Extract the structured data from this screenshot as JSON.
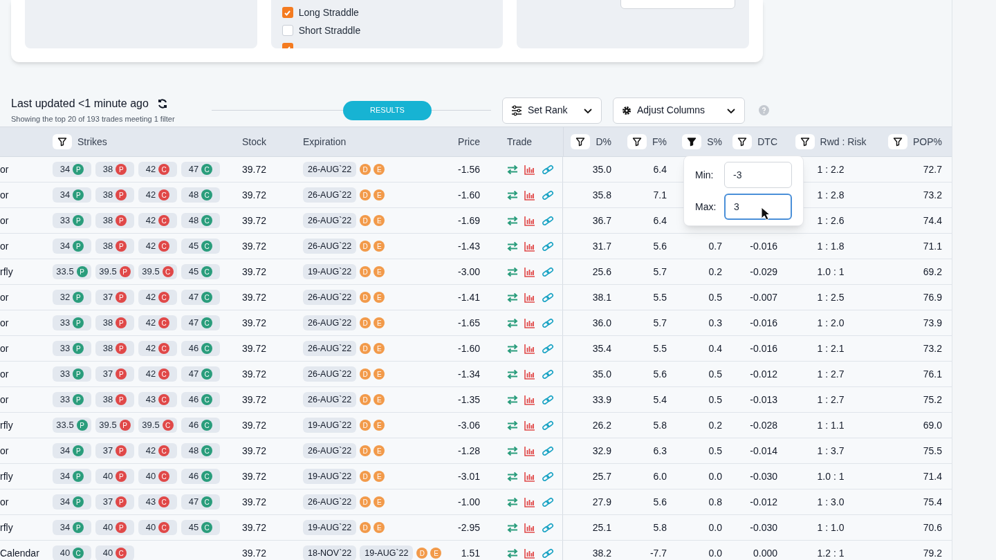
{
  "strategies_panel": {
    "items": [
      {
        "label": "Long Straddle",
        "checked": true
      },
      {
        "label": "Short Straddle",
        "checked": false
      },
      {
        "checked": true
      }
    ]
  },
  "results_header": {
    "title": "Last updated <1 minute ago",
    "subtitle": "Showing the top 20 of 193 trades meeting 1 filter",
    "divider_label": "RESULTS",
    "buttons": [
      {
        "label": "Set Rank",
        "kind": "rank"
      },
      {
        "label": "Adjust Columns",
        "kind": "columns"
      }
    ]
  },
  "table": {
    "columns": [
      {
        "label": "Strikes",
        "filter": true,
        "filter_active": false
      },
      {
        "label": "Stock",
        "filter": false
      },
      {
        "label": "Expiration",
        "filter": false
      },
      {
        "label": "Price",
        "filter": false
      },
      {
        "label": "Trade",
        "filter": false
      },
      {
        "label": "D%",
        "filter": true,
        "filter_active": false
      },
      {
        "label": "F%",
        "filter": true,
        "filter_active": false
      },
      {
        "label": "S%",
        "filter": true,
        "filter_active": true
      },
      {
        "label": "DTC",
        "filter": true,
        "filter_active": false
      },
      {
        "label": "Rwd : Risk",
        "filter": true,
        "filter_active": false
      },
      {
        "label": "POP%",
        "filter": true,
        "filter_active": false
      }
    ],
    "rows": [
      {
        "name": "or",
        "strikes": [
          {
            "value": "34",
            "type": "P",
            "color": "#2a9d7c"
          },
          {
            "value": "38",
            "type": "P",
            "color": "#e04848"
          },
          {
            "value": "42",
            "type": "C",
            "color": "#e04848"
          },
          {
            "value": "47",
            "type": "C",
            "color": "#2a9d7c"
          }
        ],
        "stock": "39.72",
        "expirations": [
          "26-AUG`22"
        ],
        "badges": [
          "D",
          "E"
        ],
        "price": "-1.56",
        "d": "35.0",
        "f": "6.4",
        "rwd_risk": "1 : 2.2",
        "pop": "72.7"
      },
      {
        "name": "or",
        "strikes": [
          {
            "value": "34",
            "type": "P",
            "color": "#2a9d7c"
          },
          {
            "value": "38",
            "type": "P",
            "color": "#e04848"
          },
          {
            "value": "42",
            "type": "C",
            "color": "#e04848"
          },
          {
            "value": "48",
            "type": "C",
            "color": "#2a9d7c"
          }
        ],
        "stock": "39.72",
        "expirations": [
          "26-AUG`22"
        ],
        "badges": [
          "D",
          "E"
        ],
        "price": "-1.60",
        "d": "35.8",
        "f": "7.1",
        "rwd_risk": "1 : 2.8",
        "pop": "73.2"
      },
      {
        "name": "or",
        "strikes": [
          {
            "value": "33",
            "type": "P",
            "color": "#2a9d7c"
          },
          {
            "value": "38",
            "type": "P",
            "color": "#e04848"
          },
          {
            "value": "42",
            "type": "C",
            "color": "#e04848"
          },
          {
            "value": "48",
            "type": "C",
            "color": "#2a9d7c"
          }
        ],
        "stock": "39.72",
        "expirations": [
          "26-AUG`22"
        ],
        "badges": [
          "D",
          "E"
        ],
        "price": "-1.69",
        "d": "36.7",
        "f": "6.4",
        "rwd_risk": "1 : 2.6",
        "pop": "74.4"
      },
      {
        "name": "or",
        "strikes": [
          {
            "value": "34",
            "type": "P",
            "color": "#2a9d7c"
          },
          {
            "value": "38",
            "type": "P",
            "color": "#e04848"
          },
          {
            "value": "42",
            "type": "C",
            "color": "#e04848"
          },
          {
            "value": "45",
            "type": "C",
            "color": "#2a9d7c"
          }
        ],
        "stock": "39.72",
        "expirations": [
          "26-AUG`22"
        ],
        "badges": [
          "D",
          "E"
        ],
        "price": "-1.43",
        "d": "31.7",
        "f": "5.6",
        "s": "0.7",
        "dtc": "-0.016",
        "rwd_risk": "1 : 1.8",
        "pop": "71.1"
      },
      {
        "name": "rfly",
        "strikes": [
          {
            "value": "33.5",
            "type": "P",
            "color": "#2a9d7c"
          },
          {
            "value": "39.5",
            "type": "P",
            "color": "#e04848"
          },
          {
            "value": "39.5",
            "type": "C",
            "color": "#e04848"
          },
          {
            "value": "45",
            "type": "C",
            "color": "#2a9d7c"
          }
        ],
        "stock": "39.72",
        "expirations": [
          "19-AUG`22"
        ],
        "badges": [
          "D",
          "E"
        ],
        "price": "-3.00",
        "d": "25.6",
        "f": "5.7",
        "s": "0.2",
        "dtc": "-0.029",
        "rwd_risk": "1.0 : 1",
        "pop": "69.2"
      },
      {
        "name": "or",
        "strikes": [
          {
            "value": "32",
            "type": "P",
            "color": "#2a9d7c"
          },
          {
            "value": "37",
            "type": "P",
            "color": "#e04848"
          },
          {
            "value": "42",
            "type": "C",
            "color": "#e04848"
          },
          {
            "value": "47",
            "type": "C",
            "color": "#2a9d7c"
          }
        ],
        "stock": "39.72",
        "expirations": [
          "26-AUG`22"
        ],
        "badges": [
          "D",
          "E"
        ],
        "price": "-1.41",
        "d": "38.1",
        "f": "5.5",
        "s": "0.5",
        "dtc": "-0.007",
        "rwd_risk": "1 : 2.5",
        "pop": "76.9"
      },
      {
        "name": "or",
        "strikes": [
          {
            "value": "33",
            "type": "P",
            "color": "#2a9d7c"
          },
          {
            "value": "38",
            "type": "P",
            "color": "#e04848"
          },
          {
            "value": "42",
            "type": "C",
            "color": "#e04848"
          },
          {
            "value": "47",
            "type": "C",
            "color": "#2a9d7c"
          }
        ],
        "stock": "39.72",
        "expirations": [
          "26-AUG`22"
        ],
        "badges": [
          "D",
          "E"
        ],
        "price": "-1.65",
        "d": "36.0",
        "f": "5.7",
        "s": "0.3",
        "dtc": "-0.016",
        "rwd_risk": "1 : 2.0",
        "pop": "73.9"
      },
      {
        "name": "or",
        "strikes": [
          {
            "value": "33",
            "type": "P",
            "color": "#2a9d7c"
          },
          {
            "value": "38",
            "type": "P",
            "color": "#e04848"
          },
          {
            "value": "42",
            "type": "C",
            "color": "#e04848"
          },
          {
            "value": "46",
            "type": "C",
            "color": "#2a9d7c"
          }
        ],
        "stock": "39.72",
        "expirations": [
          "26-AUG`22"
        ],
        "badges": [
          "D",
          "E"
        ],
        "price": "-1.60",
        "d": "35.4",
        "f": "5.5",
        "s": "0.4",
        "dtc": "-0.016",
        "rwd_risk": "1 : 2.1",
        "pop": "73.2"
      },
      {
        "name": "or",
        "strikes": [
          {
            "value": "33",
            "type": "P",
            "color": "#2a9d7c"
          },
          {
            "value": "37",
            "type": "P",
            "color": "#e04848"
          },
          {
            "value": "42",
            "type": "C",
            "color": "#e04848"
          },
          {
            "value": "47",
            "type": "C",
            "color": "#2a9d7c"
          }
        ],
        "stock": "39.72",
        "expirations": [
          "26-AUG`22"
        ],
        "badges": [
          "D",
          "E"
        ],
        "price": "-1.34",
        "d": "35.0",
        "f": "5.6",
        "s": "0.5",
        "dtc": "-0.012",
        "rwd_risk": "1 : 2.7",
        "pop": "76.1"
      },
      {
        "name": "or",
        "strikes": [
          {
            "value": "33",
            "type": "P",
            "color": "#2a9d7c"
          },
          {
            "value": "38",
            "type": "P",
            "color": "#e04848"
          },
          {
            "value": "43",
            "type": "C",
            "color": "#e04848"
          },
          {
            "value": "46",
            "type": "C",
            "color": "#2a9d7c"
          }
        ],
        "stock": "39.72",
        "expirations": [
          "26-AUG`22"
        ],
        "badges": [
          "D",
          "E"
        ],
        "price": "-1.35",
        "d": "33.9",
        "f": "5.4",
        "s": "0.5",
        "dtc": "-0.013",
        "rwd_risk": "1 : 2.7",
        "pop": "75.2"
      },
      {
        "name": "rfly",
        "strikes": [
          {
            "value": "33.5",
            "type": "P",
            "color": "#2a9d7c"
          },
          {
            "value": "39.5",
            "type": "P",
            "color": "#e04848"
          },
          {
            "value": "39.5",
            "type": "C",
            "color": "#e04848"
          },
          {
            "value": "46",
            "type": "C",
            "color": "#2a9d7c"
          }
        ],
        "stock": "39.72",
        "expirations": [
          "19-AUG`22"
        ],
        "badges": [
          "D",
          "E"
        ],
        "price": "-3.06",
        "d": "26.2",
        "f": "5.8",
        "s": "0.2",
        "dtc": "-0.028",
        "rwd_risk": "1 : 1.1",
        "pop": "69.0"
      },
      {
        "name": "or",
        "strikes": [
          {
            "value": "34",
            "type": "P",
            "color": "#2a9d7c"
          },
          {
            "value": "37",
            "type": "P",
            "color": "#e04848"
          },
          {
            "value": "42",
            "type": "C",
            "color": "#e04848"
          },
          {
            "value": "48",
            "type": "C",
            "color": "#2a9d7c"
          }
        ],
        "stock": "39.72",
        "expirations": [
          "26-AUG`22"
        ],
        "badges": [
          "D",
          "E"
        ],
        "price": "-1.28",
        "d": "32.9",
        "f": "6.3",
        "s": "0.5",
        "dtc": "-0.014",
        "rwd_risk": "1 : 3.7",
        "pop": "75.5"
      },
      {
        "name": "rfly",
        "strikes": [
          {
            "value": "34",
            "type": "P",
            "color": "#2a9d7c"
          },
          {
            "value": "40",
            "type": "P",
            "color": "#e04848"
          },
          {
            "value": "40",
            "type": "C",
            "color": "#e04848"
          },
          {
            "value": "46",
            "type": "C",
            "color": "#2a9d7c"
          }
        ],
        "stock": "39.72",
        "expirations": [
          "19-AUG`22"
        ],
        "badges": [
          "D",
          "E"
        ],
        "price": "-3.01",
        "d": "25.7",
        "f": "6.0",
        "s": "0.0",
        "dtc": "-0.030",
        "rwd_risk": "1.0 : 1",
        "pop": "71.4"
      },
      {
        "name": "or",
        "strikes": [
          {
            "value": "34",
            "type": "P",
            "color": "#2a9d7c"
          },
          {
            "value": "37",
            "type": "P",
            "color": "#e04848"
          },
          {
            "value": "43",
            "type": "C",
            "color": "#e04848"
          },
          {
            "value": "47",
            "type": "C",
            "color": "#2a9d7c"
          }
        ],
        "stock": "39.72",
        "expirations": [
          "26-AUG`22"
        ],
        "badges": [
          "D",
          "E"
        ],
        "price": "-1.00",
        "d": "27.9",
        "f": "5.6",
        "s": "0.8",
        "dtc": "-0.012",
        "rwd_risk": "1 : 3.0",
        "pop": "75.4"
      },
      {
        "name": "rfly",
        "strikes": [
          {
            "value": "34",
            "type": "P",
            "color": "#2a9d7c"
          },
          {
            "value": "40",
            "type": "P",
            "color": "#e04848"
          },
          {
            "value": "40",
            "type": "C",
            "color": "#e04848"
          },
          {
            "value": "45",
            "type": "C",
            "color": "#2a9d7c"
          }
        ],
        "stock": "39.72",
        "expirations": [
          "19-AUG`22"
        ],
        "badges": [
          "D",
          "E"
        ],
        "price": "-2.95",
        "d": "25.1",
        "f": "5.8",
        "s": "0.0",
        "dtc": "-0.030",
        "rwd_risk": "1 : 1.0",
        "pop": "70.6"
      },
      {
        "name": "Calendar",
        "strikes": [
          {
            "value": "40",
            "type": "C",
            "color": "#2a9d7c"
          },
          {
            "value": "40",
            "type": "C",
            "color": "#e04848"
          }
        ],
        "stock": "39.72",
        "expirations": [
          "18-NOV`22",
          "19-AUG`22"
        ],
        "badges": [
          "D",
          "E"
        ],
        "price": "1.51",
        "d": "38.2",
        "f": "-7.7",
        "s": "0.0",
        "dtc": "0.000",
        "rwd_risk": "1.2 : 1",
        "pop": "79.2"
      }
    ]
  },
  "filter_popover": {
    "fields": [
      {
        "label": "Min:",
        "value": "-3",
        "focused": false
      },
      {
        "label": "Max:",
        "value": "3",
        "focused": true
      }
    ]
  }
}
